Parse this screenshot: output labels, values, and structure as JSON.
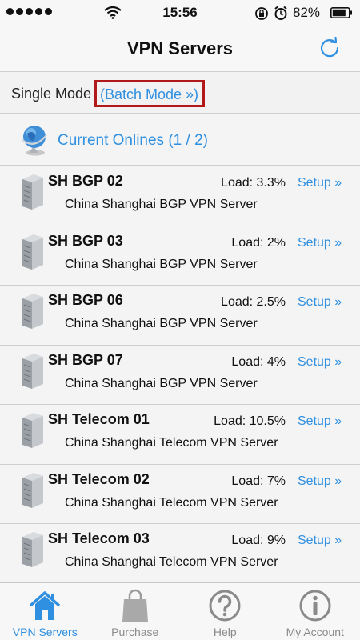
{
  "status_bar": {
    "time": "15:56",
    "battery": "82%"
  },
  "nav": {
    "title": "VPN Servers",
    "refresh_icon": "refresh-icon"
  },
  "mode": {
    "single_label": "Single Mode",
    "batch_label": "(Batch Mode »)"
  },
  "onlines": {
    "label": "Current Onlines (1 / 2)",
    "icon": "globe-icon"
  },
  "servers": [
    {
      "name": "SH BGP 02",
      "load": "Load: 3.3%",
      "setup": "Setup »",
      "desc": "China Shanghai BGP VPN Server"
    },
    {
      "name": "SH BGP 03",
      "load": "Load: 2%",
      "setup": "Setup »",
      "desc": "China Shanghai BGP VPN Server"
    },
    {
      "name": "SH BGP 06",
      "load": "Load: 2.5%",
      "setup": "Setup »",
      "desc": "China Shanghai BGP VPN Server"
    },
    {
      "name": "SH BGP 07",
      "load": "Load: 4%",
      "setup": "Setup »",
      "desc": "China Shanghai BGP VPN Server"
    },
    {
      "name": "SH Telecom 01",
      "load": "Load: 10.5%",
      "setup": "Setup »",
      "desc": "China Shanghai Telecom VPN Server"
    },
    {
      "name": "SH Telecom 02",
      "load": "Load: 7%",
      "setup": "Setup »",
      "desc": "China Shanghai Telecom VPN Server"
    },
    {
      "name": "SH Telecom 03",
      "load": "Load: 9%",
      "setup": "Setup »",
      "desc": "China Shanghai Telecom VPN Server"
    }
  ],
  "tabs": [
    {
      "label": "VPN Servers",
      "icon": "home-icon",
      "active": true
    },
    {
      "label": "Purchase",
      "icon": "shopping-bag-icon",
      "active": false
    },
    {
      "label": "Help",
      "icon": "question-icon",
      "active": false
    },
    {
      "label": "My Account",
      "icon": "info-icon",
      "active": false
    }
  ],
  "colors": {
    "accent": "#2f8fe0",
    "highlight_border": "#b21a1a",
    "inactive_tab": "#8a8a8a"
  }
}
